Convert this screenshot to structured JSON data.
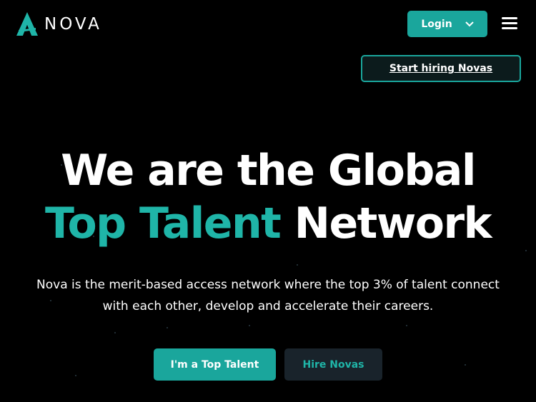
{
  "brand": {
    "name": "NOVA",
    "accent_color": "#1aa69c"
  },
  "header": {
    "login_label": "Login",
    "login_icon": "chevron-down-icon",
    "menu_icon": "hamburger-menu-icon"
  },
  "cta": {
    "start_hiring_label": "Start hiring Novas"
  },
  "hero": {
    "title_line1": "We are the Global",
    "title_accent": "Top Talent",
    "title_rest": "Network",
    "subtitle_line1": "Nova is the merit-based access network where the top 3% of talent connect",
    "subtitle_line2": "with each other, develop and accelerate their careers.",
    "primary_button": "I'm a Top Talent",
    "secondary_button": "Hire Novas"
  }
}
